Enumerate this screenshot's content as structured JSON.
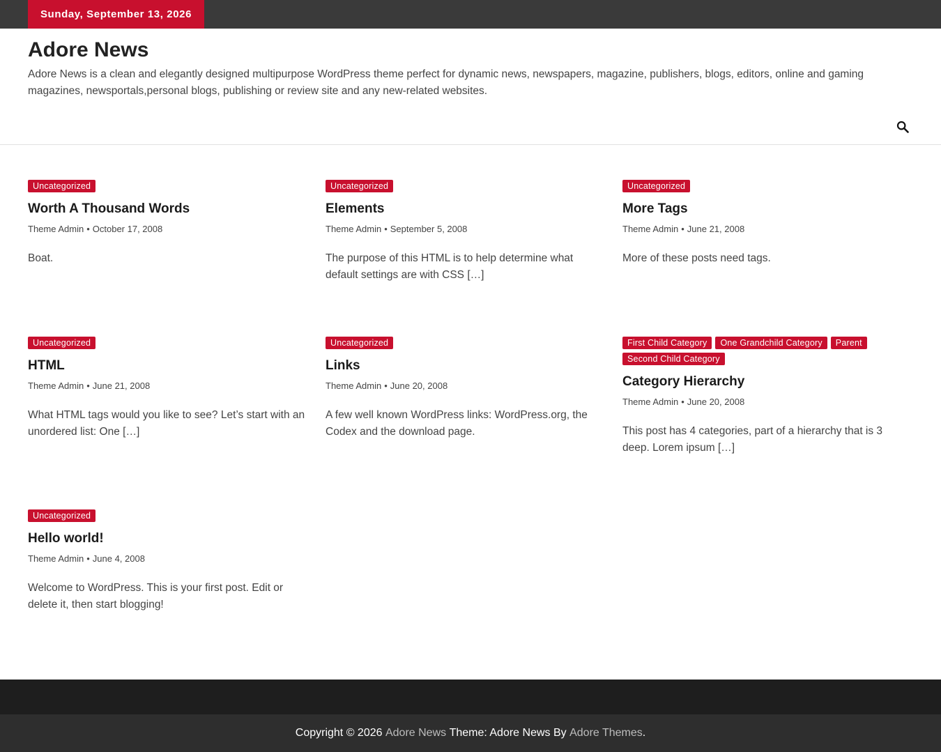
{
  "topbar": {
    "date": "Sunday, September 13, 2026"
  },
  "header": {
    "title": "Adore News",
    "description": "Adore News is a clean and elegantly designed multipurpose WordPress theme perfect for dynamic news, newspapers, magazine, publishers, blogs, editors, online and gaming magazines, newsportals,personal blogs, publishing or review site and any new-related websites.",
    "search_icon": "search-icon"
  },
  "posts": [
    {
      "categories": [
        "Uncategorized"
      ],
      "title": "Worth A Thousand Words",
      "author": "Theme Admin",
      "date": "October 17, 2008",
      "excerpt": "Boat."
    },
    {
      "categories": [
        "Uncategorized"
      ],
      "title": "Elements",
      "author": "Theme Admin",
      "date": "September 5, 2008",
      "excerpt": "The purpose of this HTML is to help determine what default settings are with CSS […]"
    },
    {
      "categories": [
        "Uncategorized"
      ],
      "title": "More Tags",
      "author": "Theme Admin",
      "date": "June 21, 2008",
      "excerpt": "More of these posts need tags."
    },
    {
      "categories": [
        "Uncategorized"
      ],
      "title": "HTML",
      "author": "Theme Admin",
      "date": "June 21, 2008",
      "excerpt": "What HTML tags would you like to see? Let’s start with an unordered list: One […]"
    },
    {
      "categories": [
        "Uncategorized"
      ],
      "title": "Links",
      "author": "Theme Admin",
      "date": "June 20, 2008",
      "excerpt": "A few well known WordPress links: WordPress.org, the Codex and the download page."
    },
    {
      "categories": [
        "First Child Category",
        "One Grandchild Category",
        "Parent",
        "Second Child Category"
      ],
      "title": "Category Hierarchy",
      "author": "Theme Admin",
      "date": "June 20, 2008",
      "excerpt": "This post has 4 categories, part of a hierarchy that is 3 deep. Lorem ipsum […]"
    },
    {
      "categories": [
        "Uncategorized"
      ],
      "title": "Hello world!",
      "author": "Theme Admin",
      "date": "June 4, 2008",
      "excerpt": "Welcome to WordPress. This is your first post. Edit or delete it, then start blogging!"
    }
  ],
  "footer": {
    "copyright": "Copyright © 2026",
    "site_link": "Adore News",
    "theme_text": "Theme: Adore News By",
    "author_link": "Adore Themes",
    "end": "."
  },
  "colors": {
    "accent": "#c8102e",
    "topbar": "#3a3a3a",
    "footer_dark": "#1e1e1e",
    "footer_bottom": "#2e2e2e"
  }
}
